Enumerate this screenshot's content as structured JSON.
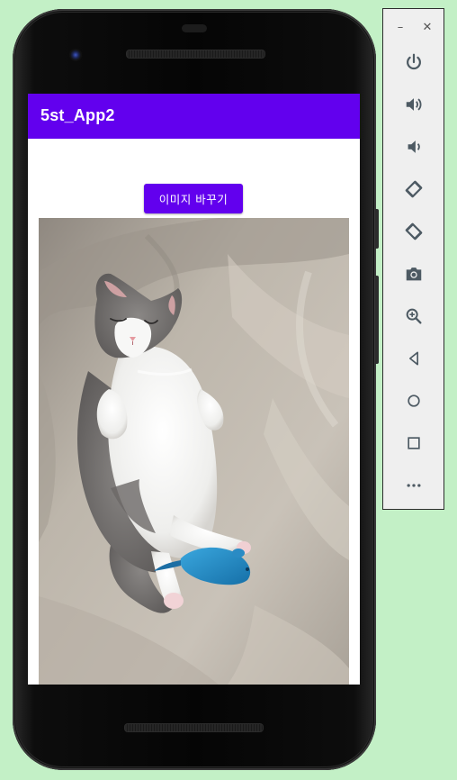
{
  "app": {
    "title": "5st_App2",
    "change_image_button_label": "이미지 바꾸기",
    "accent_color": "#6200ee"
  },
  "photo": {
    "subject": "sleeping-kitten-with-toy-mouse"
  },
  "emulator_toolbar": {
    "window_controls": [
      {
        "name": "minimize",
        "glyph": "–"
      },
      {
        "name": "close",
        "glyph": "✕"
      }
    ],
    "buttons": [
      "power-icon",
      "volume-up-icon",
      "volume-down-icon",
      "rotate-left-icon",
      "rotate-right-icon",
      "screenshot-icon",
      "zoom-icon",
      "back-icon",
      "home-icon",
      "overview-icon",
      "more-icon"
    ]
  }
}
